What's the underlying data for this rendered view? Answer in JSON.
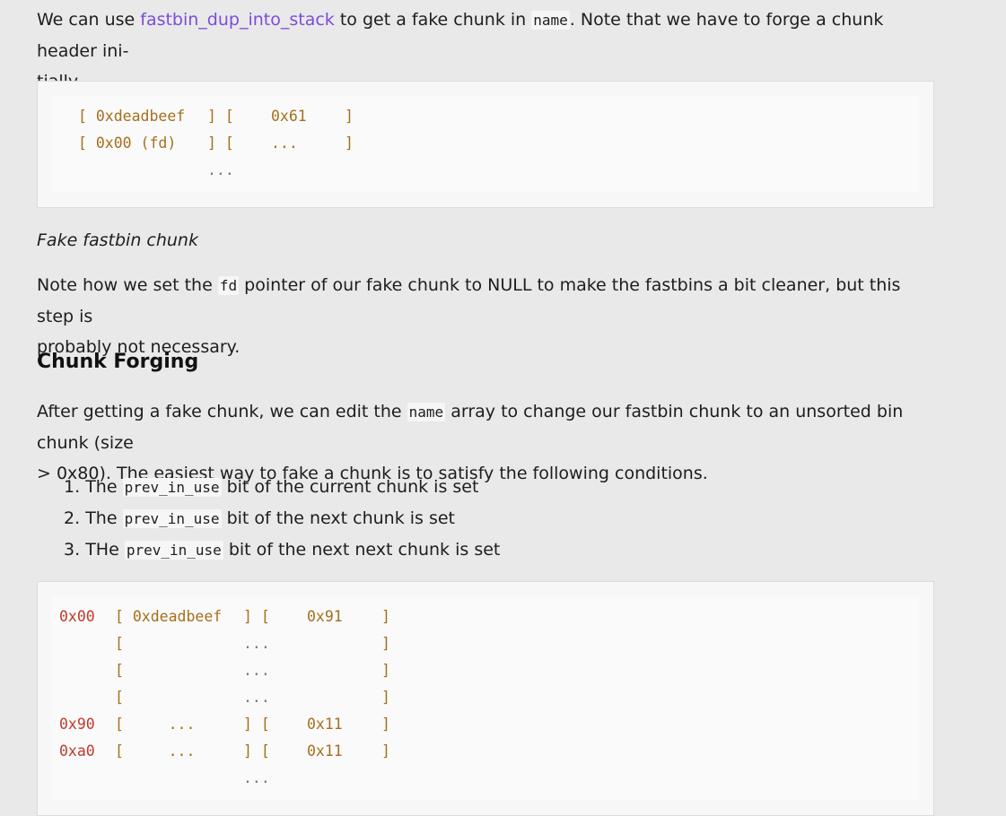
{
  "intro": {
    "prefix": "We can use ",
    "link": "fastbin_dup_into_stack",
    "middle": " to get a fake chunk in ",
    "code": "name",
    "suffix_line1": ". Note that we have to forge a chunk header ini-",
    "suffix_line2": "tially."
  },
  "code1": {
    "rows": [
      {
        "a": "[ 0xdeadbeef",
        "b": "] [",
        "c": "0x61",
        "d": "]"
      },
      {
        "a": "[ 0x00 (fd)",
        "b": "] [",
        "c": "...",
        "d": "]"
      }
    ],
    "tail": "..."
  },
  "caption": "Fake fastbin chunk",
  "note": {
    "prefix": "Note how we set the ",
    "code": "fd",
    "suffix_line1": " pointer of our fake chunk to NULL to make the fastbins a bit cleaner, but this step is",
    "suffix_line2": "probably not necessary."
  },
  "heading": "Chunk Forging",
  "para2": {
    "prefix": "After getting a fake chunk, we can edit the ",
    "code": "name",
    "suffix_line1": " array to change our fastbin chunk to an unsorted bin chunk (size",
    "line2": "> 0x80). The easiest way to fake a chunk is to satisfy the following conditions."
  },
  "list": [
    {
      "num": "1.",
      "prefix": "The ",
      "code": "prev_in_use",
      "suffix": " bit of the current chunk is set"
    },
    {
      "num": "2.",
      "prefix": "The ",
      "code": "prev_in_use",
      "suffix": " bit of the next chunk is set"
    },
    {
      "num": "3.",
      "prefix": "THe ",
      "code": "prev_in_use",
      "suffix": " bit of the next next chunk is set"
    }
  ],
  "code2": {
    "rows": [
      {
        "off": "0x00",
        "a": "[ 0xdeadbeef",
        "b": "] [",
        "c": "0x91",
        "d": "]"
      },
      {
        "off": "",
        "a": "[",
        "b": "...",
        "c": "",
        "d": "]"
      },
      {
        "off": "",
        "a": "[",
        "b": "...",
        "c": "",
        "d": "]"
      },
      {
        "off": "",
        "a": "[",
        "b": "...",
        "c": "",
        "d": "]"
      },
      {
        "off": "0x90",
        "a": "[     ...",
        "b": "] [",
        "c": "0x11",
        "d": "]"
      },
      {
        "off": "0xa0",
        "a": "[     ...",
        "b": "] [",
        "c": "0x11",
        "d": "]"
      }
    ],
    "tail": "..."
  }
}
